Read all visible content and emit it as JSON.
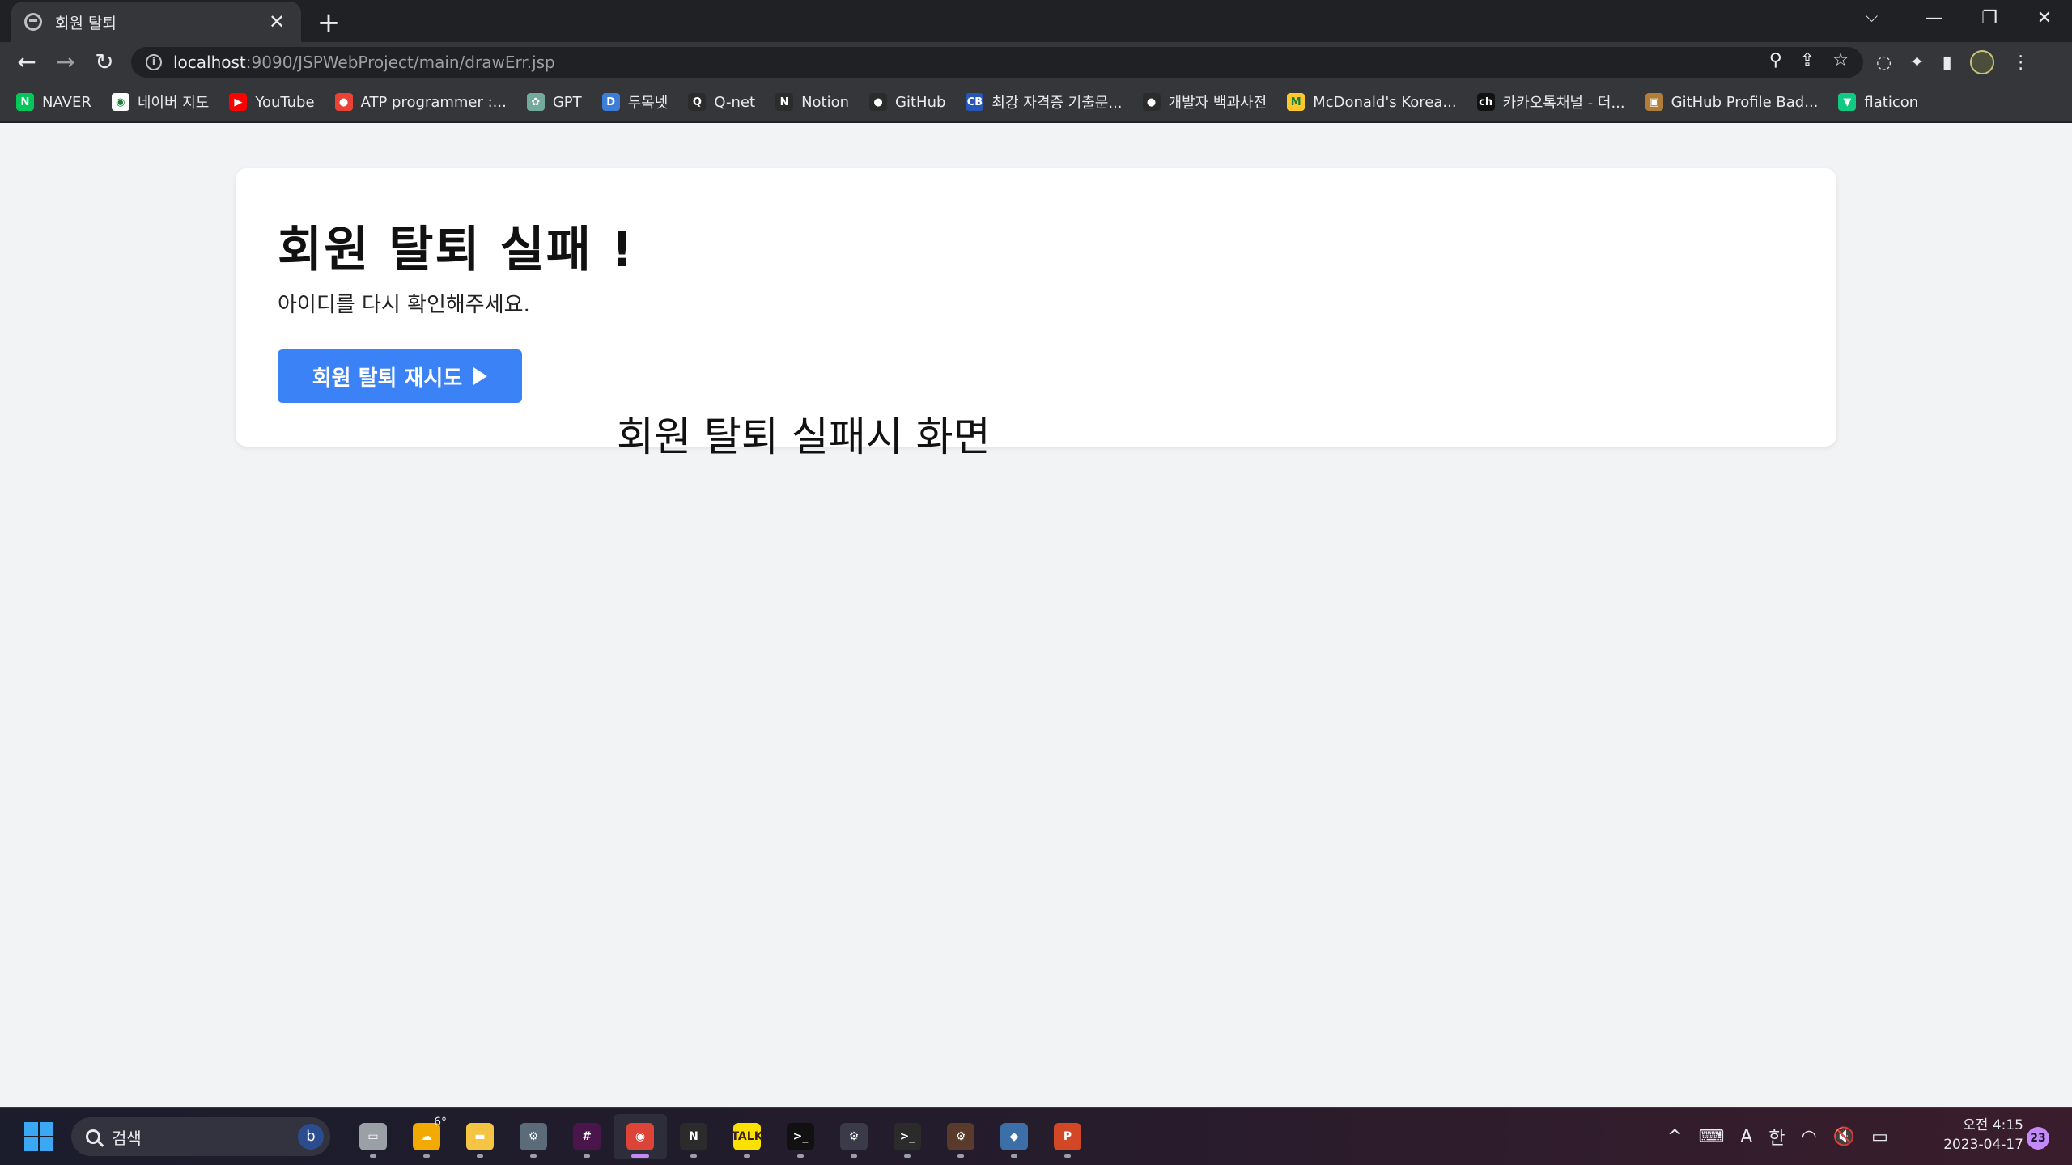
{
  "browser": {
    "tab": {
      "title": "회원 탈퇴",
      "close": "✕"
    },
    "new_tab": "+",
    "window_controls": {
      "tab_search": "⌵",
      "minimize": "—",
      "restore": "❐",
      "close": "✕"
    },
    "nav": {
      "back": "←",
      "forward": "→",
      "reload": "↻"
    },
    "address": {
      "host": "localhost",
      "path": ":9090/JSPWebProject/main/drawErr.jsp",
      "info": "i"
    },
    "omnibox_actions": {
      "zoom": "⚲",
      "share": "⇪",
      "bookmark": "☆"
    },
    "toolbar_actions": {
      "loading": "◌",
      "extensions": "✦",
      "side_panel": "▮",
      "menu": "⋮"
    }
  },
  "bookmarks": [
    {
      "label": "NAVER",
      "icon": "naver-icon",
      "glyph": "N",
      "color": "#03c75a"
    },
    {
      "label": "네이버 지도",
      "icon": "naver-map-icon",
      "glyph": "◉",
      "color": "#ffffff"
    },
    {
      "label": "YouTube",
      "icon": "youtube-icon",
      "glyph": "▶",
      "color": "#ff0000"
    },
    {
      "label": "ATP programmer :...",
      "icon": "atp-icon",
      "glyph": "●",
      "color": "#ea4335"
    },
    {
      "label": "GPT",
      "icon": "openai-icon",
      "glyph": "✿",
      "color": "#74aa9c"
    },
    {
      "label": "두목넷",
      "icon": "dumok-icon",
      "glyph": "D",
      "color": "#3b7dd8"
    },
    {
      "label": "Q-net",
      "icon": "qnet-icon",
      "glyph": "Q",
      "color": "#2b2b2b"
    },
    {
      "label": "Notion",
      "icon": "notion-icon",
      "glyph": "N",
      "color": "#2b2b2b"
    },
    {
      "label": "GitHub",
      "icon": "github-icon",
      "glyph": "●",
      "color": "#2b2b2b"
    },
    {
      "label": "최강 자격증 기출문...",
      "icon": "cbt-icon",
      "glyph": "CB",
      "color": "#2855b8"
    },
    {
      "label": "개발자 백과사전",
      "icon": "github-icon",
      "glyph": "●",
      "color": "#2b2b2b"
    },
    {
      "label": "McDonald's Korea...",
      "icon": "mcdonalds-icon",
      "glyph": "M",
      "color": "#ffc72c"
    },
    {
      "label": "카카오톡채널 - 더...",
      "icon": "kakao-channel-icon",
      "glyph": "ch",
      "color": "#111111"
    },
    {
      "label": "GitHub Profile Bad...",
      "icon": "badge-icon",
      "glyph": "▣",
      "color": "#b07d3a"
    },
    {
      "label": "flaticon",
      "icon": "flaticon-icon",
      "glyph": "▼",
      "color": "#0fca80"
    }
  ],
  "page": {
    "title": "회원 탈퇴 실패 !",
    "message": "아이디를 다시 확인해주세요.",
    "retry_button": "회원 탈퇴 재시도",
    "caption": "회원 탈퇴 실패시 화면"
  },
  "taskbar": {
    "search_placeholder": "검색",
    "bing": "b",
    "weather_temp": "6°",
    "apps": [
      {
        "name": "task-view-icon",
        "glyph": "▭",
        "color": "#9aa0a6",
        "active": false
      },
      {
        "name": "weather-icon",
        "glyph": "☁",
        "color": "#f2a900",
        "active": false
      },
      {
        "name": "file-explorer-icon",
        "glyph": "▬",
        "color": "#f6c443",
        "active": false
      },
      {
        "name": "settings-icon",
        "glyph": "⚙",
        "color": "#5c6b7a",
        "active": false
      },
      {
        "name": "slack-icon",
        "glyph": "#",
        "color": "#4a154b",
        "active": false
      },
      {
        "name": "chrome-icon",
        "glyph": "◉",
        "color": "#db4437",
        "active": true
      },
      {
        "name": "notion-icon",
        "glyph": "N",
        "color": "#2b2b2b",
        "active": false
      },
      {
        "name": "kakaotalk-icon",
        "glyph": "TALK",
        "color": "#fae100",
        "active": false
      },
      {
        "name": "terminal-icon",
        "glyph": ">_",
        "color": "#111111",
        "active": false
      },
      {
        "name": "gear-app-icon",
        "glyph": "⚙",
        "color": "#3a3a48",
        "active": false
      },
      {
        "name": "powershell-icon",
        "glyph": ">_",
        "color": "#2b2b2b",
        "active": false
      },
      {
        "name": "eclipse-icon",
        "glyph": "⚙",
        "color": "#5a3a2a",
        "active": false
      },
      {
        "name": "mysql-workbench-icon",
        "glyph": "◆",
        "color": "#3c6ea8",
        "active": false
      },
      {
        "name": "powerpoint-icon",
        "glyph": "P",
        "color": "#d24726",
        "active": false
      }
    ],
    "tray": {
      "chevron": "^",
      "keyboard": "⌨",
      "ime_mode": "A",
      "ime_lang": "한",
      "wifi": "◠",
      "volume": "🔇",
      "battery": "▭"
    },
    "clock": {
      "time": "오전 4:15",
      "date": "2023-04-17"
    },
    "notifications": "23"
  }
}
